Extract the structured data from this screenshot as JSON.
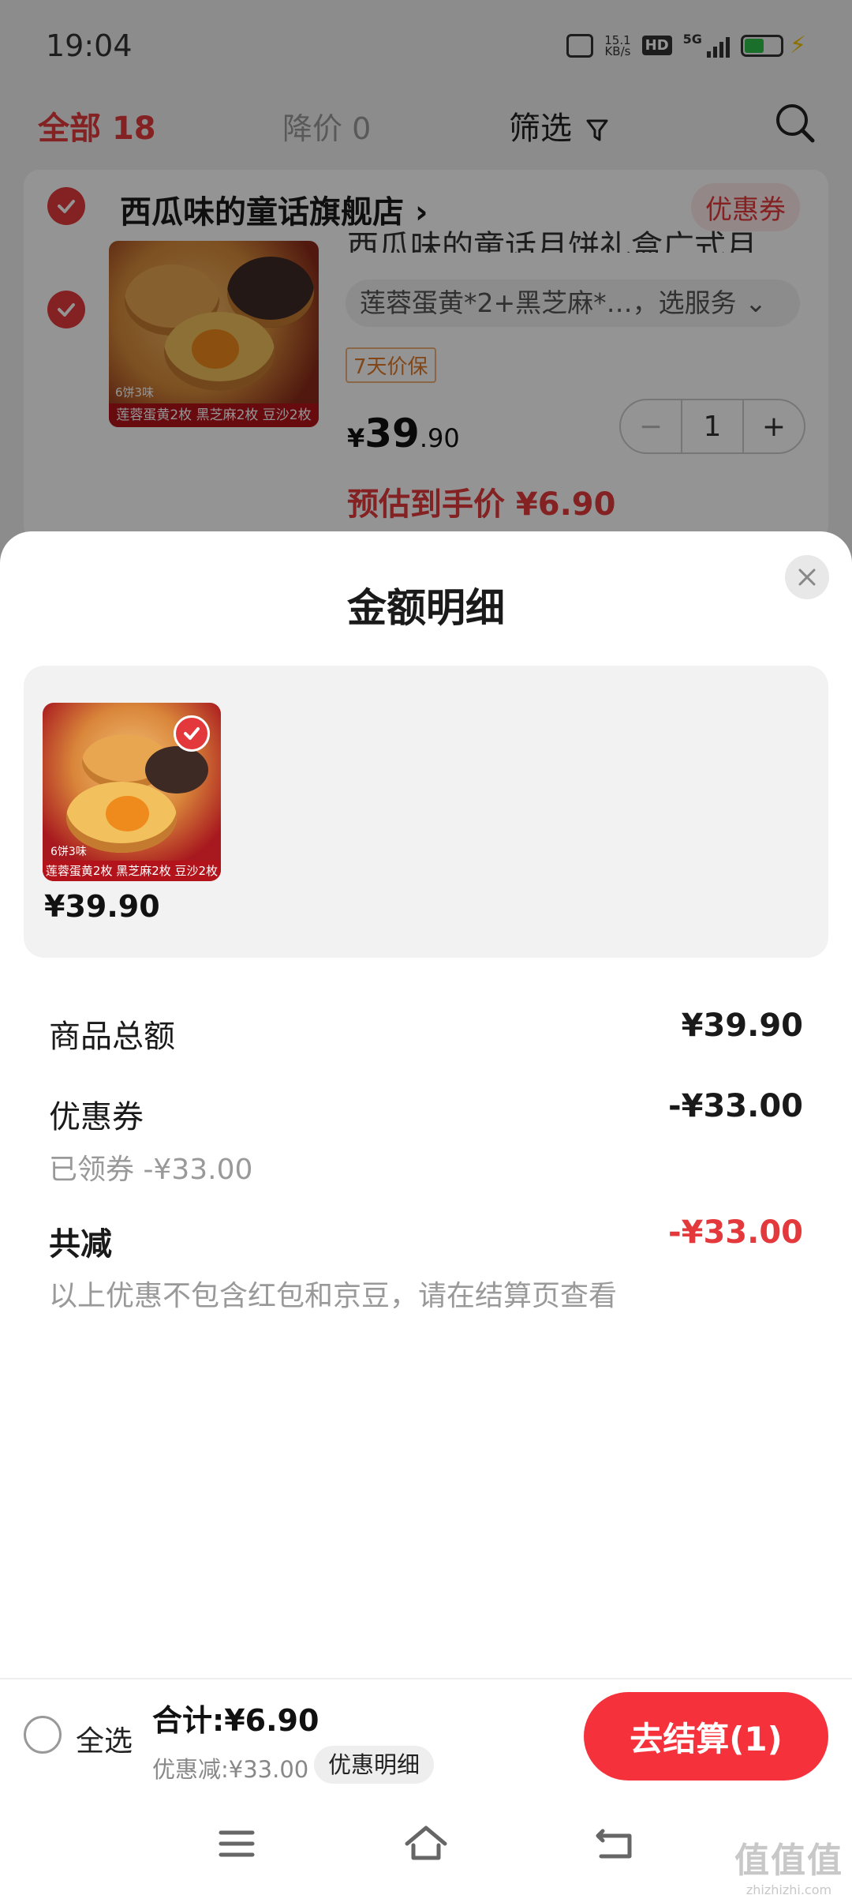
{
  "status_bar": {
    "time": "19:04",
    "net_speed_value": "15.1",
    "net_speed_unit": "KB/s",
    "hd_label": "HD",
    "network": "5G",
    "icons": [
      "vibrate-icon",
      "hd-icon",
      "signal-icon",
      "battery-icon",
      "charging-icon"
    ]
  },
  "filter_bar": {
    "all_label": "全部",
    "all_count": "18",
    "price_drop_label": "降价 0",
    "filter_label": "筛选",
    "icons": [
      "funnel-icon",
      "search-icon"
    ]
  },
  "store": {
    "name": "西瓜味的童话旗舰店",
    "arrow": "›",
    "coupon_label": "优惠券"
  },
  "cart_item": {
    "title": "西瓜味的童话月饼礼盒广式月",
    "spec": "莲蓉蛋黄*2+黑芝麻*…，选服务 ⌄",
    "guarantee": "7天价保",
    "price_yen": "¥",
    "price_int": "39",
    "price_dec": ".90",
    "quantity": "1",
    "minus": "−",
    "plus": "+",
    "estimated_price": "预估到手价 ¥6.90",
    "image_tag": "6饼3味",
    "image_caption": "莲蓉蛋黄2枚 黑芝麻2枚 豆沙2枚"
  },
  "sheet": {
    "title": "金额明细",
    "goods": [
      {
        "price": "¥39.90",
        "image_tag": "6饼3味",
        "image_caption": "莲蓉蛋黄2枚 黑芝麻2枚 豆沙2枚"
      }
    ],
    "rows": {
      "subtotal_label": "商品总额",
      "subtotal_value": "¥39.90",
      "coupon_label": "优惠券",
      "coupon_value": "-¥33.00",
      "coupon_sub": "已领券 -¥33.00",
      "reduce_label": "共减",
      "reduce_value": "-¥33.00",
      "note": "以上优惠不包含红包和京豆，请在结算页查看"
    }
  },
  "checkout": {
    "select_all": "全选",
    "total": "合计:¥6.90",
    "discount": "优惠减:¥33.00",
    "detail_button": "优惠明细",
    "checkout_button": "去结算(1)"
  },
  "nav": {
    "icons": [
      "menu-icon",
      "home-icon",
      "back-icon"
    ]
  },
  "watermark": {
    "big": "值值值",
    "small": "zhizhizhi.com"
  },
  "colors": {
    "brand_red": "#e4393c",
    "checkout_red": "#f5323c"
  }
}
